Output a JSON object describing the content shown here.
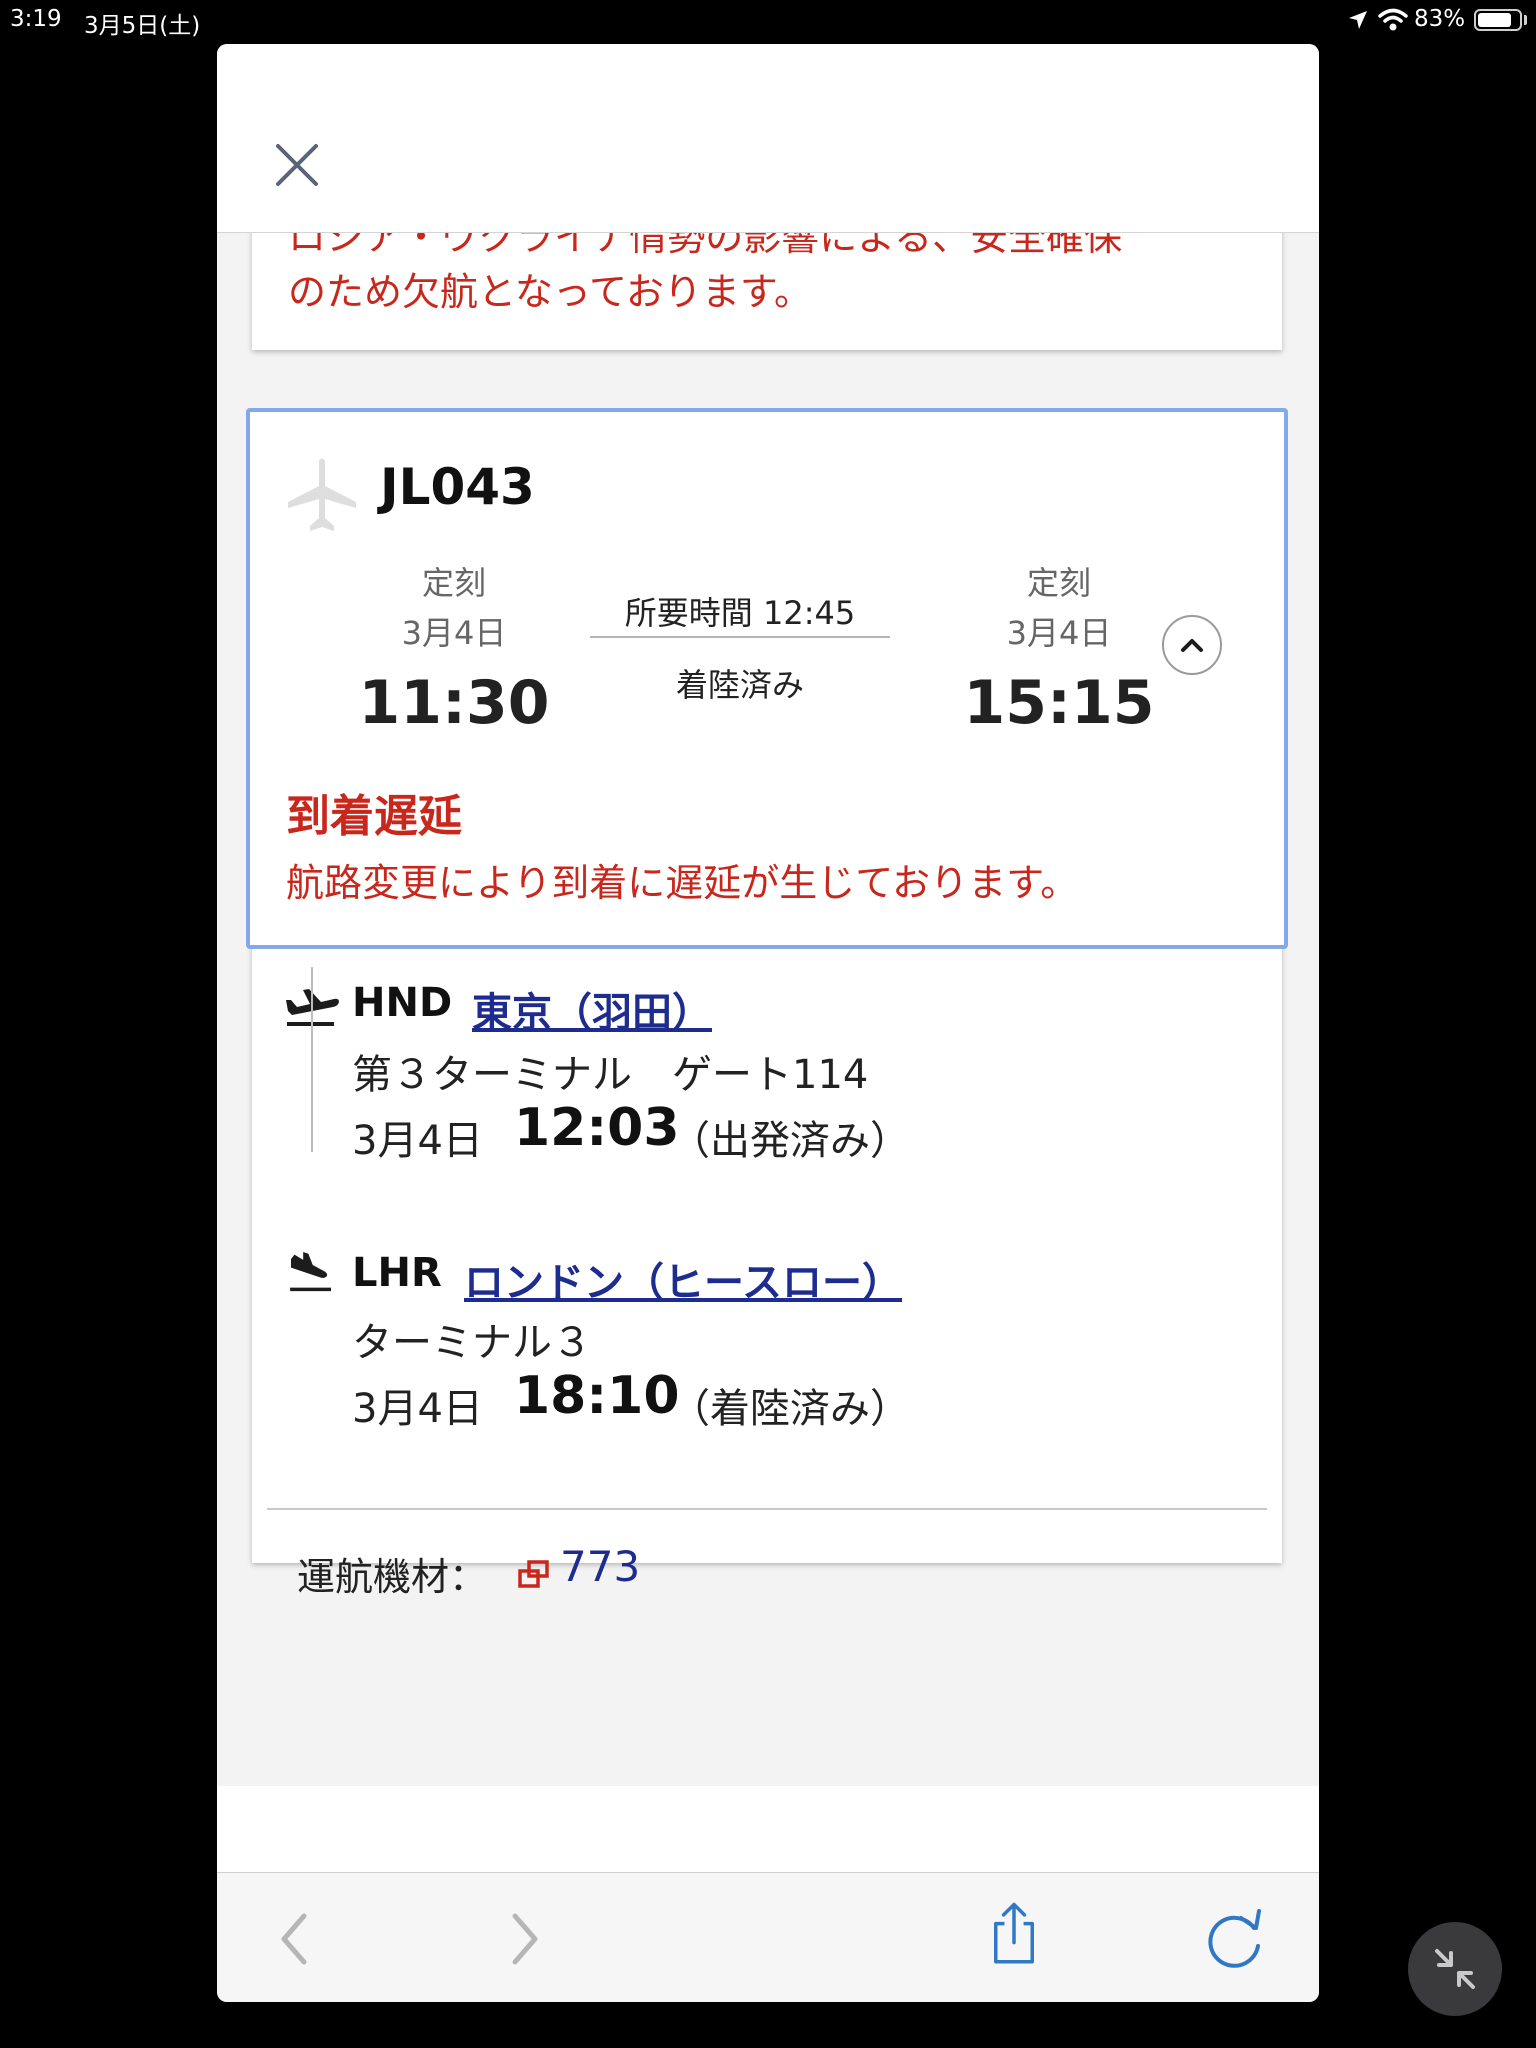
{
  "status_bar": {
    "time": "3:19",
    "date": "3月5日(土)",
    "battery_text": "83%",
    "battery_level": 0.83
  },
  "notice": {
    "line1": "ロシア・ウクライナ情勢の影響による、安全確保",
    "line2": "のため欠航となっております。"
  },
  "flight": {
    "number": "JL043",
    "departure": {
      "label": "定刻",
      "date": "3月4日",
      "time": "11:30"
    },
    "duration": "所要時間 12:45",
    "status": "着陸済み",
    "arrival": {
      "label": "定刻",
      "date": "3月4日",
      "time": "15:15"
    },
    "delay_title": "到着遅延",
    "delay_description": "航路変更により到着に遅延が生じております。"
  },
  "segments": {
    "origin": {
      "code": "HND",
      "city": "東京（羽田）",
      "terminal": "第３ターミナル　ゲート114",
      "date": "3月4日",
      "time": "12:03",
      "status": "（出発済み）"
    },
    "destination": {
      "code": "LHR",
      "city": "ロンドン（ヒースロー）",
      "terminal": "ターミナル３",
      "date": "3月4日",
      "time": "18:10",
      "status": "（着陸済み）"
    }
  },
  "equipment": {
    "label": "運航機材：",
    "value": "773"
  },
  "colors": {
    "alert_red": "#c8271c",
    "link_navy": "#1d2c8e",
    "highlight_border": "#82a9e8",
    "toolbar_blue": "#2f78c4"
  },
  "icons": {
    "close": "close-icon",
    "plane": "airplane-icon",
    "takeoff": "takeoff-icon",
    "landing": "landing-icon",
    "expand": "chevron-up-icon",
    "external": "external-link-icon",
    "back": "chevron-left-icon",
    "forward": "chevron-right-icon",
    "share": "share-icon",
    "reload": "reload-icon",
    "exit_fullscreen": "minimize-icon"
  }
}
